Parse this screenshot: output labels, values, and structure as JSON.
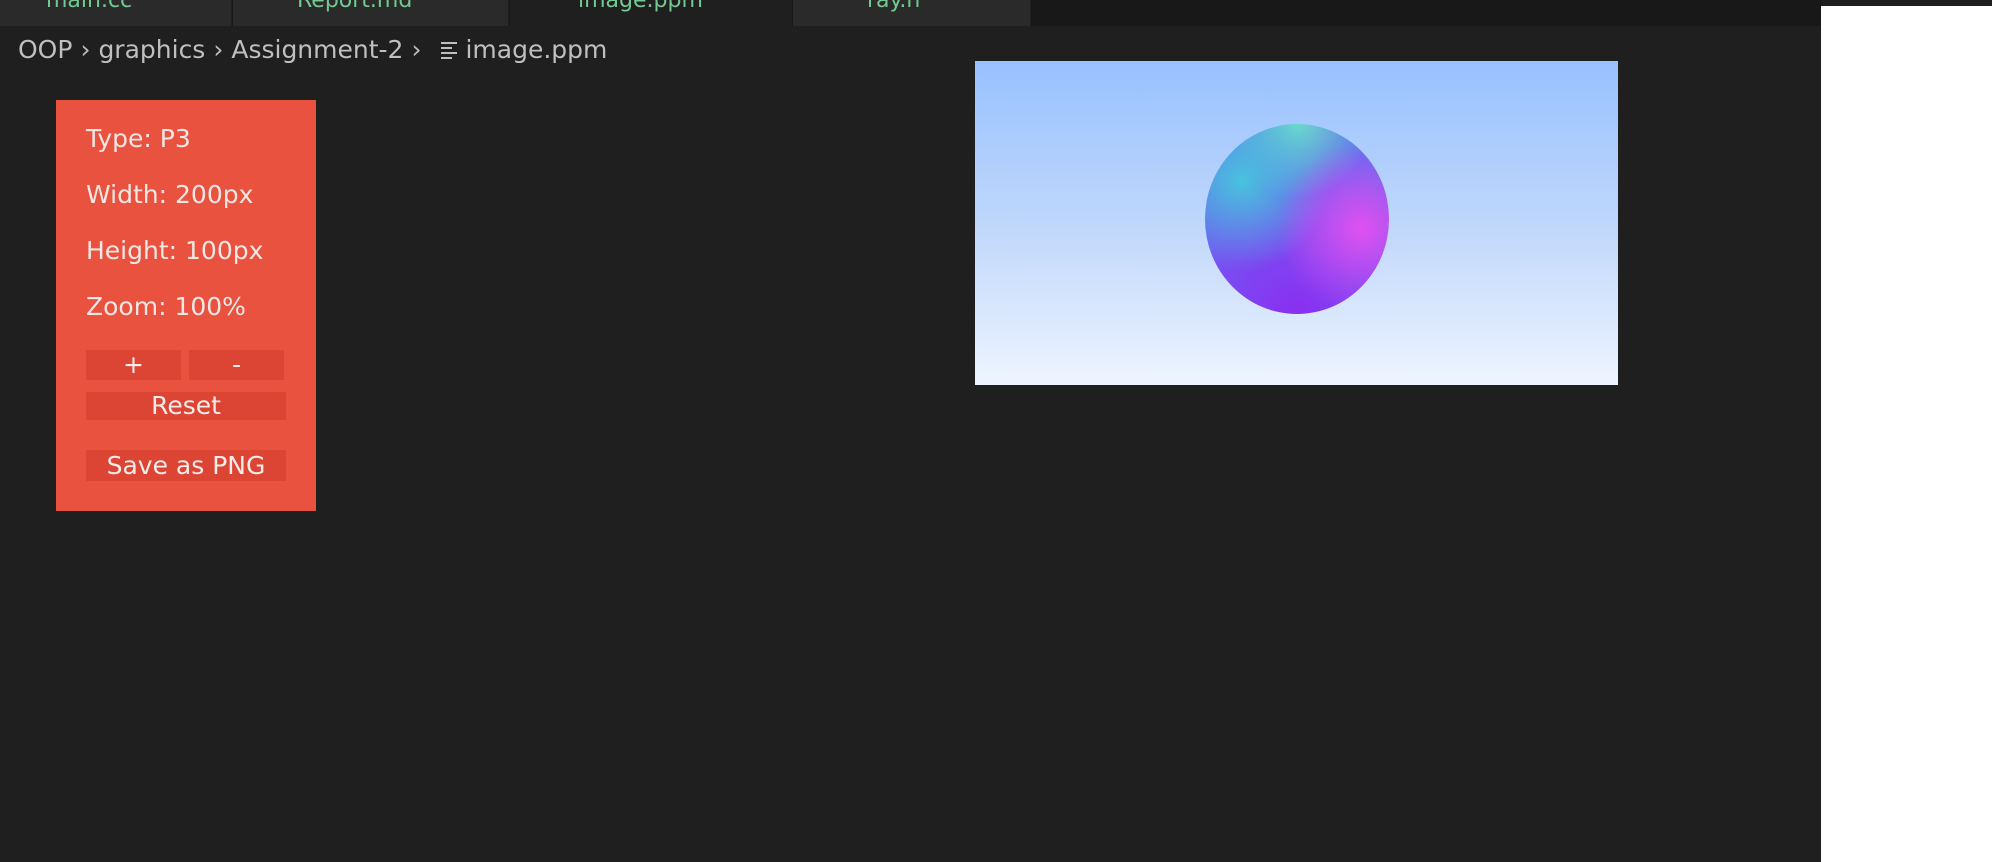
{
  "tabs": [
    {
      "label": "main.cc",
      "active": false
    },
    {
      "label": "Report.md",
      "active": false
    },
    {
      "label": "image.ppm",
      "active": true
    },
    {
      "label": "ray.h",
      "active": false
    }
  ],
  "breadcrumb": {
    "items": [
      "OOP",
      "graphics",
      "Assignment-2"
    ],
    "file": "image.ppm",
    "file_icon": "lines-file-icon"
  },
  "info_panel": {
    "type": "Type: P3",
    "width": "Width: 200px",
    "height": "Height: 100px",
    "zoom": "Zoom: 100%",
    "zoom_in_label": "+",
    "zoom_out_label": "-",
    "reset_label": "Reset",
    "save_label": "Save as PNG"
  },
  "colors": {
    "panel_bg": "#e8523e",
    "button_bg": "#dc4434",
    "editor_bg": "#1f1f1f",
    "tab_text": "#73c991"
  },
  "preview": {
    "image_name": "rendered-sphere"
  }
}
